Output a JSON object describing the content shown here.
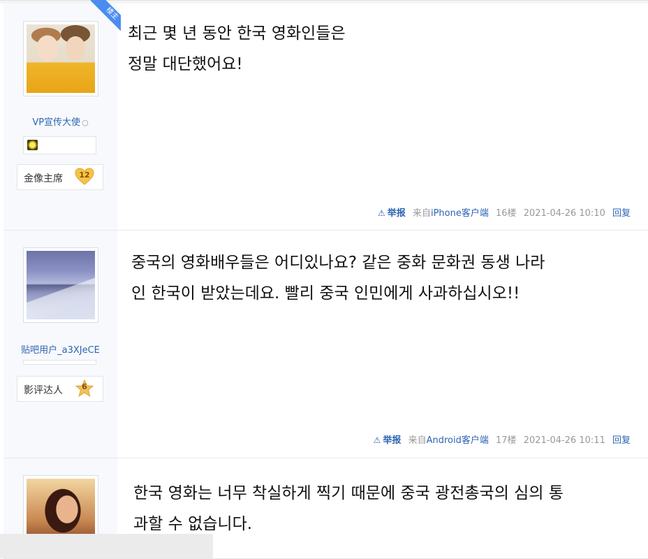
{
  "posts": [
    {
      "author_name": "VP宣传大使",
      "level_name": "金像主席",
      "level_number": "12",
      "op_tag": "楼主",
      "content_lines": [
        "최근 몇 년 동안 한국 영화인들은",
        "정말 대단했어요!"
      ],
      "report_label": "举报",
      "source_prefix": "来自",
      "source_client": "iPhone客户端",
      "floor": "16楼",
      "timestamp": "2021-04-26 10:10",
      "reply_label": "回复"
    },
    {
      "author_name": "贴吧用户_a3XJeCE",
      "level_name": "影评达人",
      "level_number": "6",
      "content_lines": [
        "중국의 영화배우들은 어디있나요? 같은 중화 문화권 동생 나라",
        "인 한국이 받았는데요. 빨리 중국 인민에게 사과하십시오!!"
      ],
      "report_label": "举报",
      "source_prefix": "来自",
      "source_client": "Android客户端",
      "floor": "17楼",
      "timestamp": "2021-04-26 10:11",
      "reply_label": "回复"
    },
    {
      "content_lines": [
        "한국 영화는 너무 착실하게 찍기 때문에 중국 광전총국의 심의 통",
        "과할 수 없습니다."
      ]
    }
  ],
  "icons": {
    "report": "warning-triangle-icon",
    "ring": "ring-icon",
    "medal": "medal-icon",
    "level_badge_colors": {
      "heart": "#f5c348",
      "star": "#f2c25a"
    }
  },
  "colors": {
    "link": "#2d64b3",
    "op_tag": "#4a8cf0",
    "author_bg": "#f7f9fc"
  }
}
